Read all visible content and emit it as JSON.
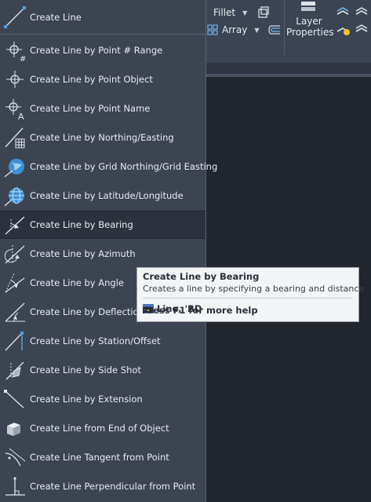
{
  "ribbon": {
    "fillet_label": "Fillet",
    "array_label": "Array",
    "layer_properties_label_1": "Layer",
    "layer_properties_label_2": "Properties"
  },
  "menu": {
    "items": [
      {
        "label": "Create Line",
        "icon": "line-icon"
      },
      {
        "label": "Create Line by Point # Range",
        "icon": "point-range-icon"
      },
      {
        "label": "Create Line by Point Object",
        "icon": "point-object-icon"
      },
      {
        "label": "Create Line by Point Name",
        "icon": "point-name-icon"
      },
      {
        "label": "Create Line by Northing/Easting",
        "icon": "northing-easting-icon"
      },
      {
        "label": "Create Line by Grid Northing/Grid Easting",
        "icon": "grid-globe-icon"
      },
      {
        "label": "Create Line by Latitude/Longitude",
        "icon": "latlong-globe-icon"
      },
      {
        "label": "Create Line by Bearing",
        "icon": "bearing-icon"
      },
      {
        "label": "Create Line by Azimuth",
        "icon": "azimuth-icon"
      },
      {
        "label": "Create Line by Angle",
        "icon": "angle-icon"
      },
      {
        "label": "Create Line by Deflection",
        "icon": "deflection-icon"
      },
      {
        "label": "Create Line by Station/Offset",
        "icon": "station-offset-icon"
      },
      {
        "label": "Create Line by Side Shot",
        "icon": "side-shot-icon"
      },
      {
        "label": "Create Line by Extension",
        "icon": "extension-icon"
      },
      {
        "label": "Create Line from End of Object",
        "icon": "end-of-object-icon"
      },
      {
        "label": "Create Line Tangent from Point",
        "icon": "tangent-icon"
      },
      {
        "label": "Create Line Perpendicular from Point",
        "icon": "perpendicular-icon"
      }
    ],
    "hovered_index": 7
  },
  "tooltip": {
    "title": "Create Line by Bearing",
    "description": "Creates a line by specifying a bearing and distance",
    "command": "Line, 'BD",
    "help": "Press F1 for more help"
  },
  "colors": {
    "menu_bg": "#3c4452",
    "hover_bg": "#2c323d",
    "tooltip_bg": "#f3f4f6",
    "accent_blue": "#4aa3df"
  }
}
